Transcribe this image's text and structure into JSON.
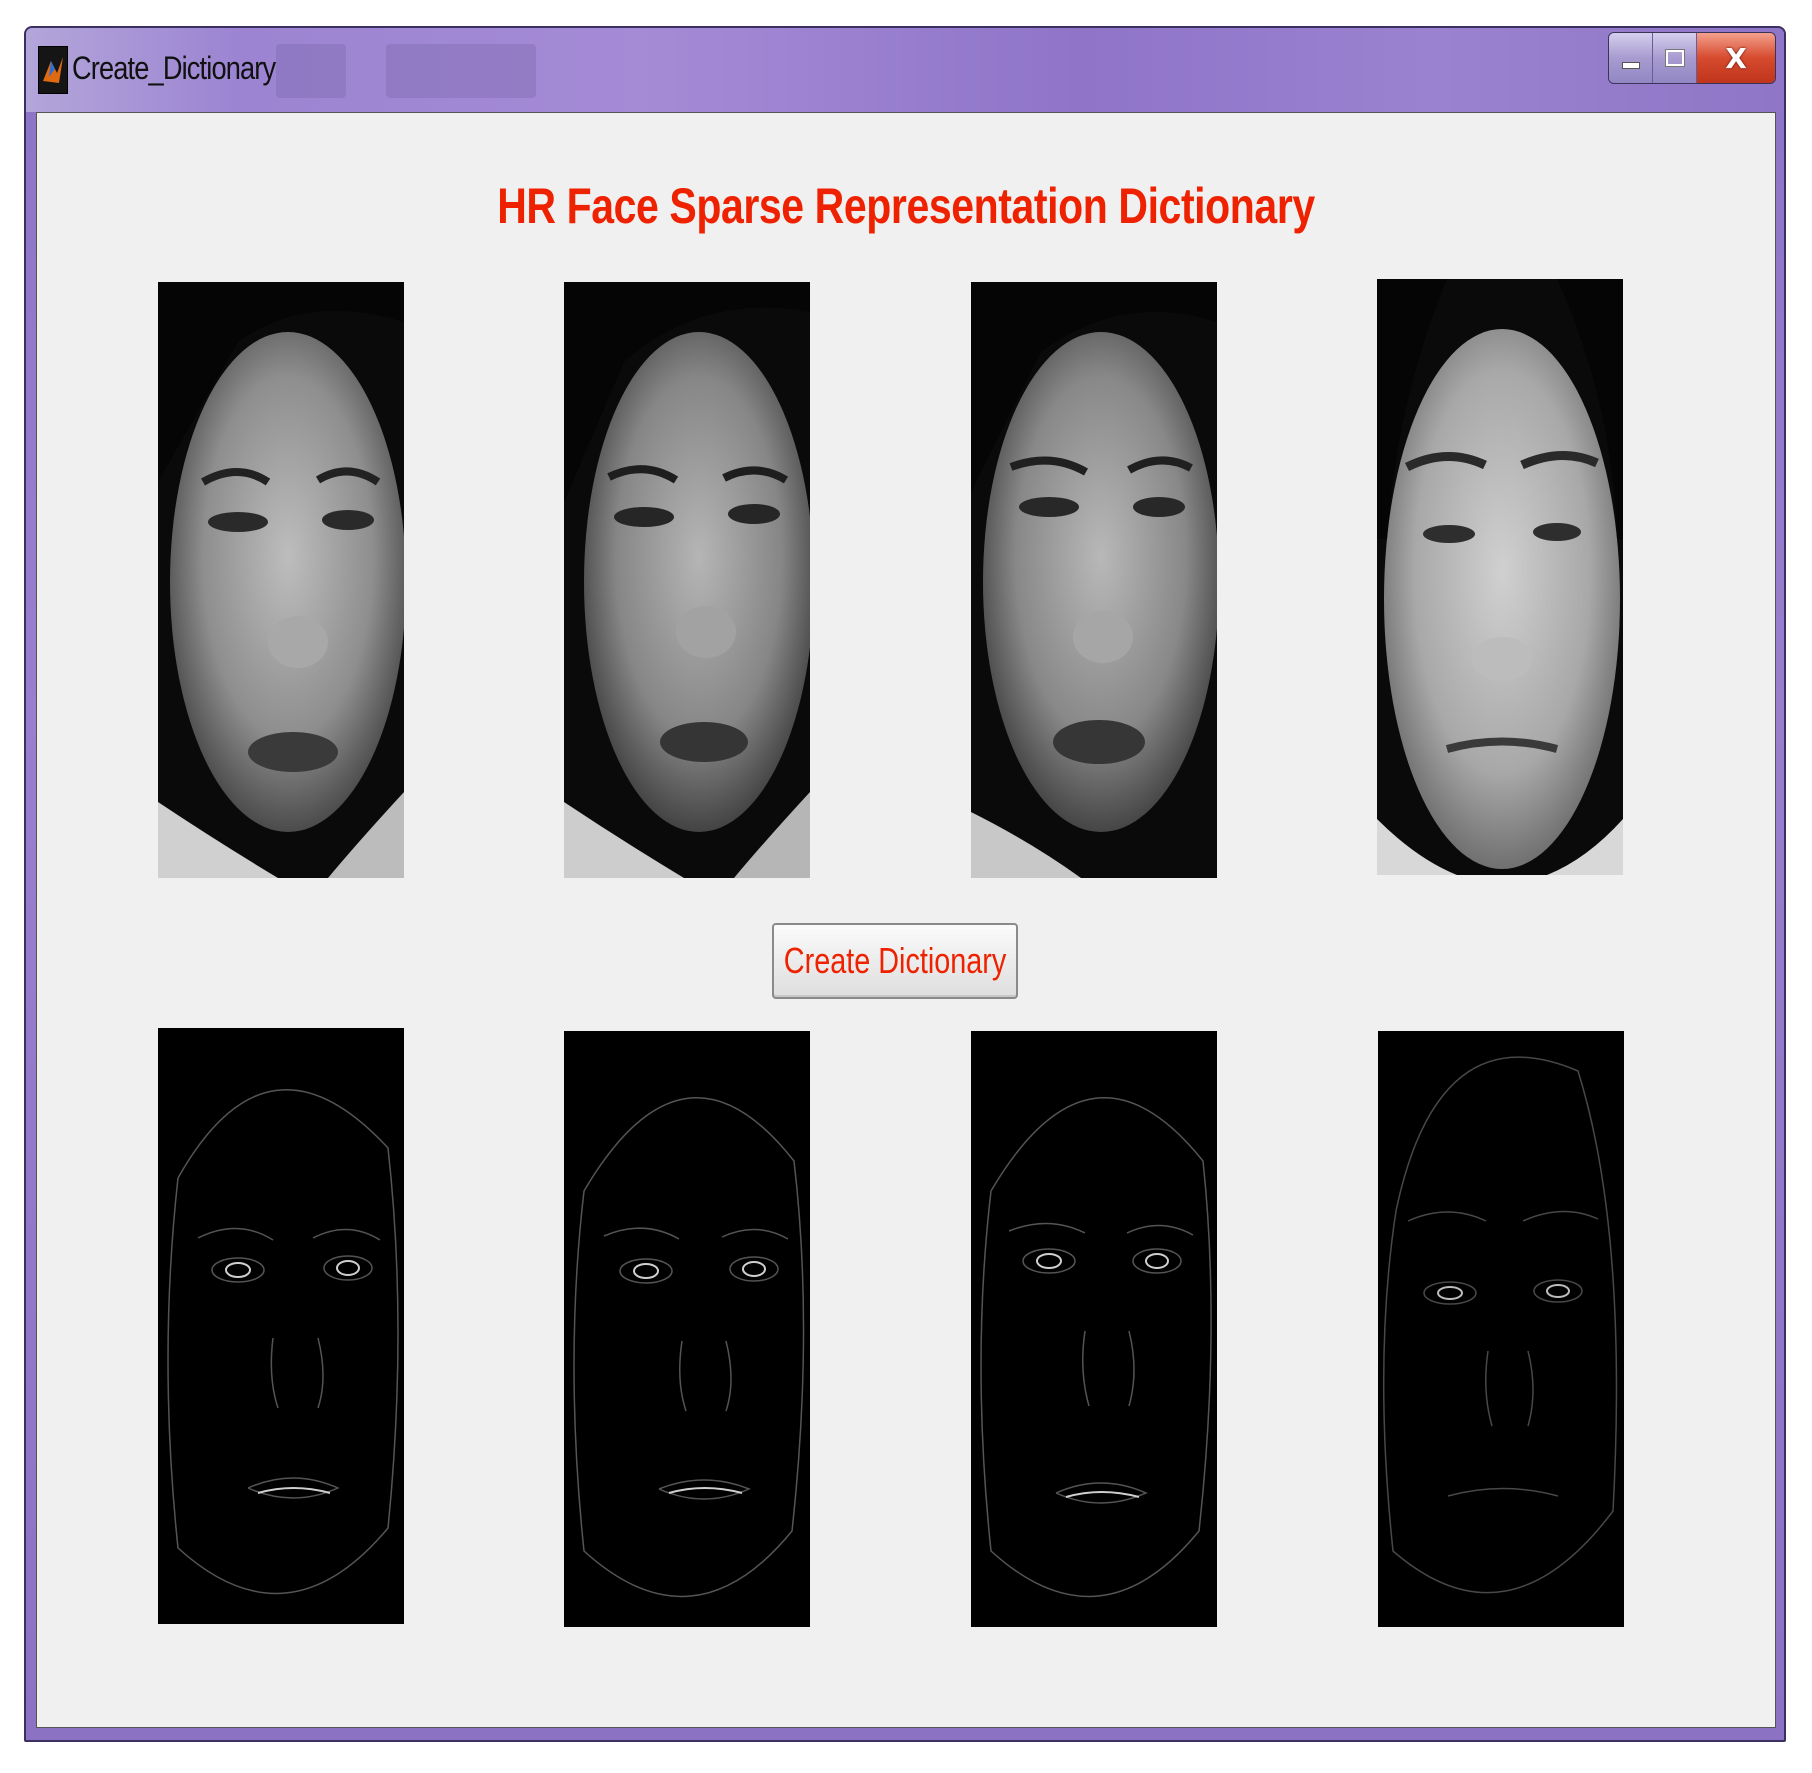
{
  "window": {
    "title": "Create_Dictionary"
  },
  "title_controls": {
    "minimize_icon": "minimize-icon",
    "maximize_icon": "maximize-icon",
    "close_label": "X"
  },
  "main": {
    "heading": "HR Face Sparse Representation Dictionary",
    "create_button_label": "Create Dictionary",
    "hr_images": [
      "hr-face-1",
      "hr-face-2",
      "hr-face-3",
      "hr-face-4"
    ],
    "dictionary_images": [
      "edge-face-1",
      "edge-face-2",
      "edge-face-3",
      "edge-face-4"
    ]
  },
  "colors": {
    "accent_red": "#ee2200",
    "titlebar": "#9b82d0",
    "client_bg": "#f0f0f0"
  }
}
